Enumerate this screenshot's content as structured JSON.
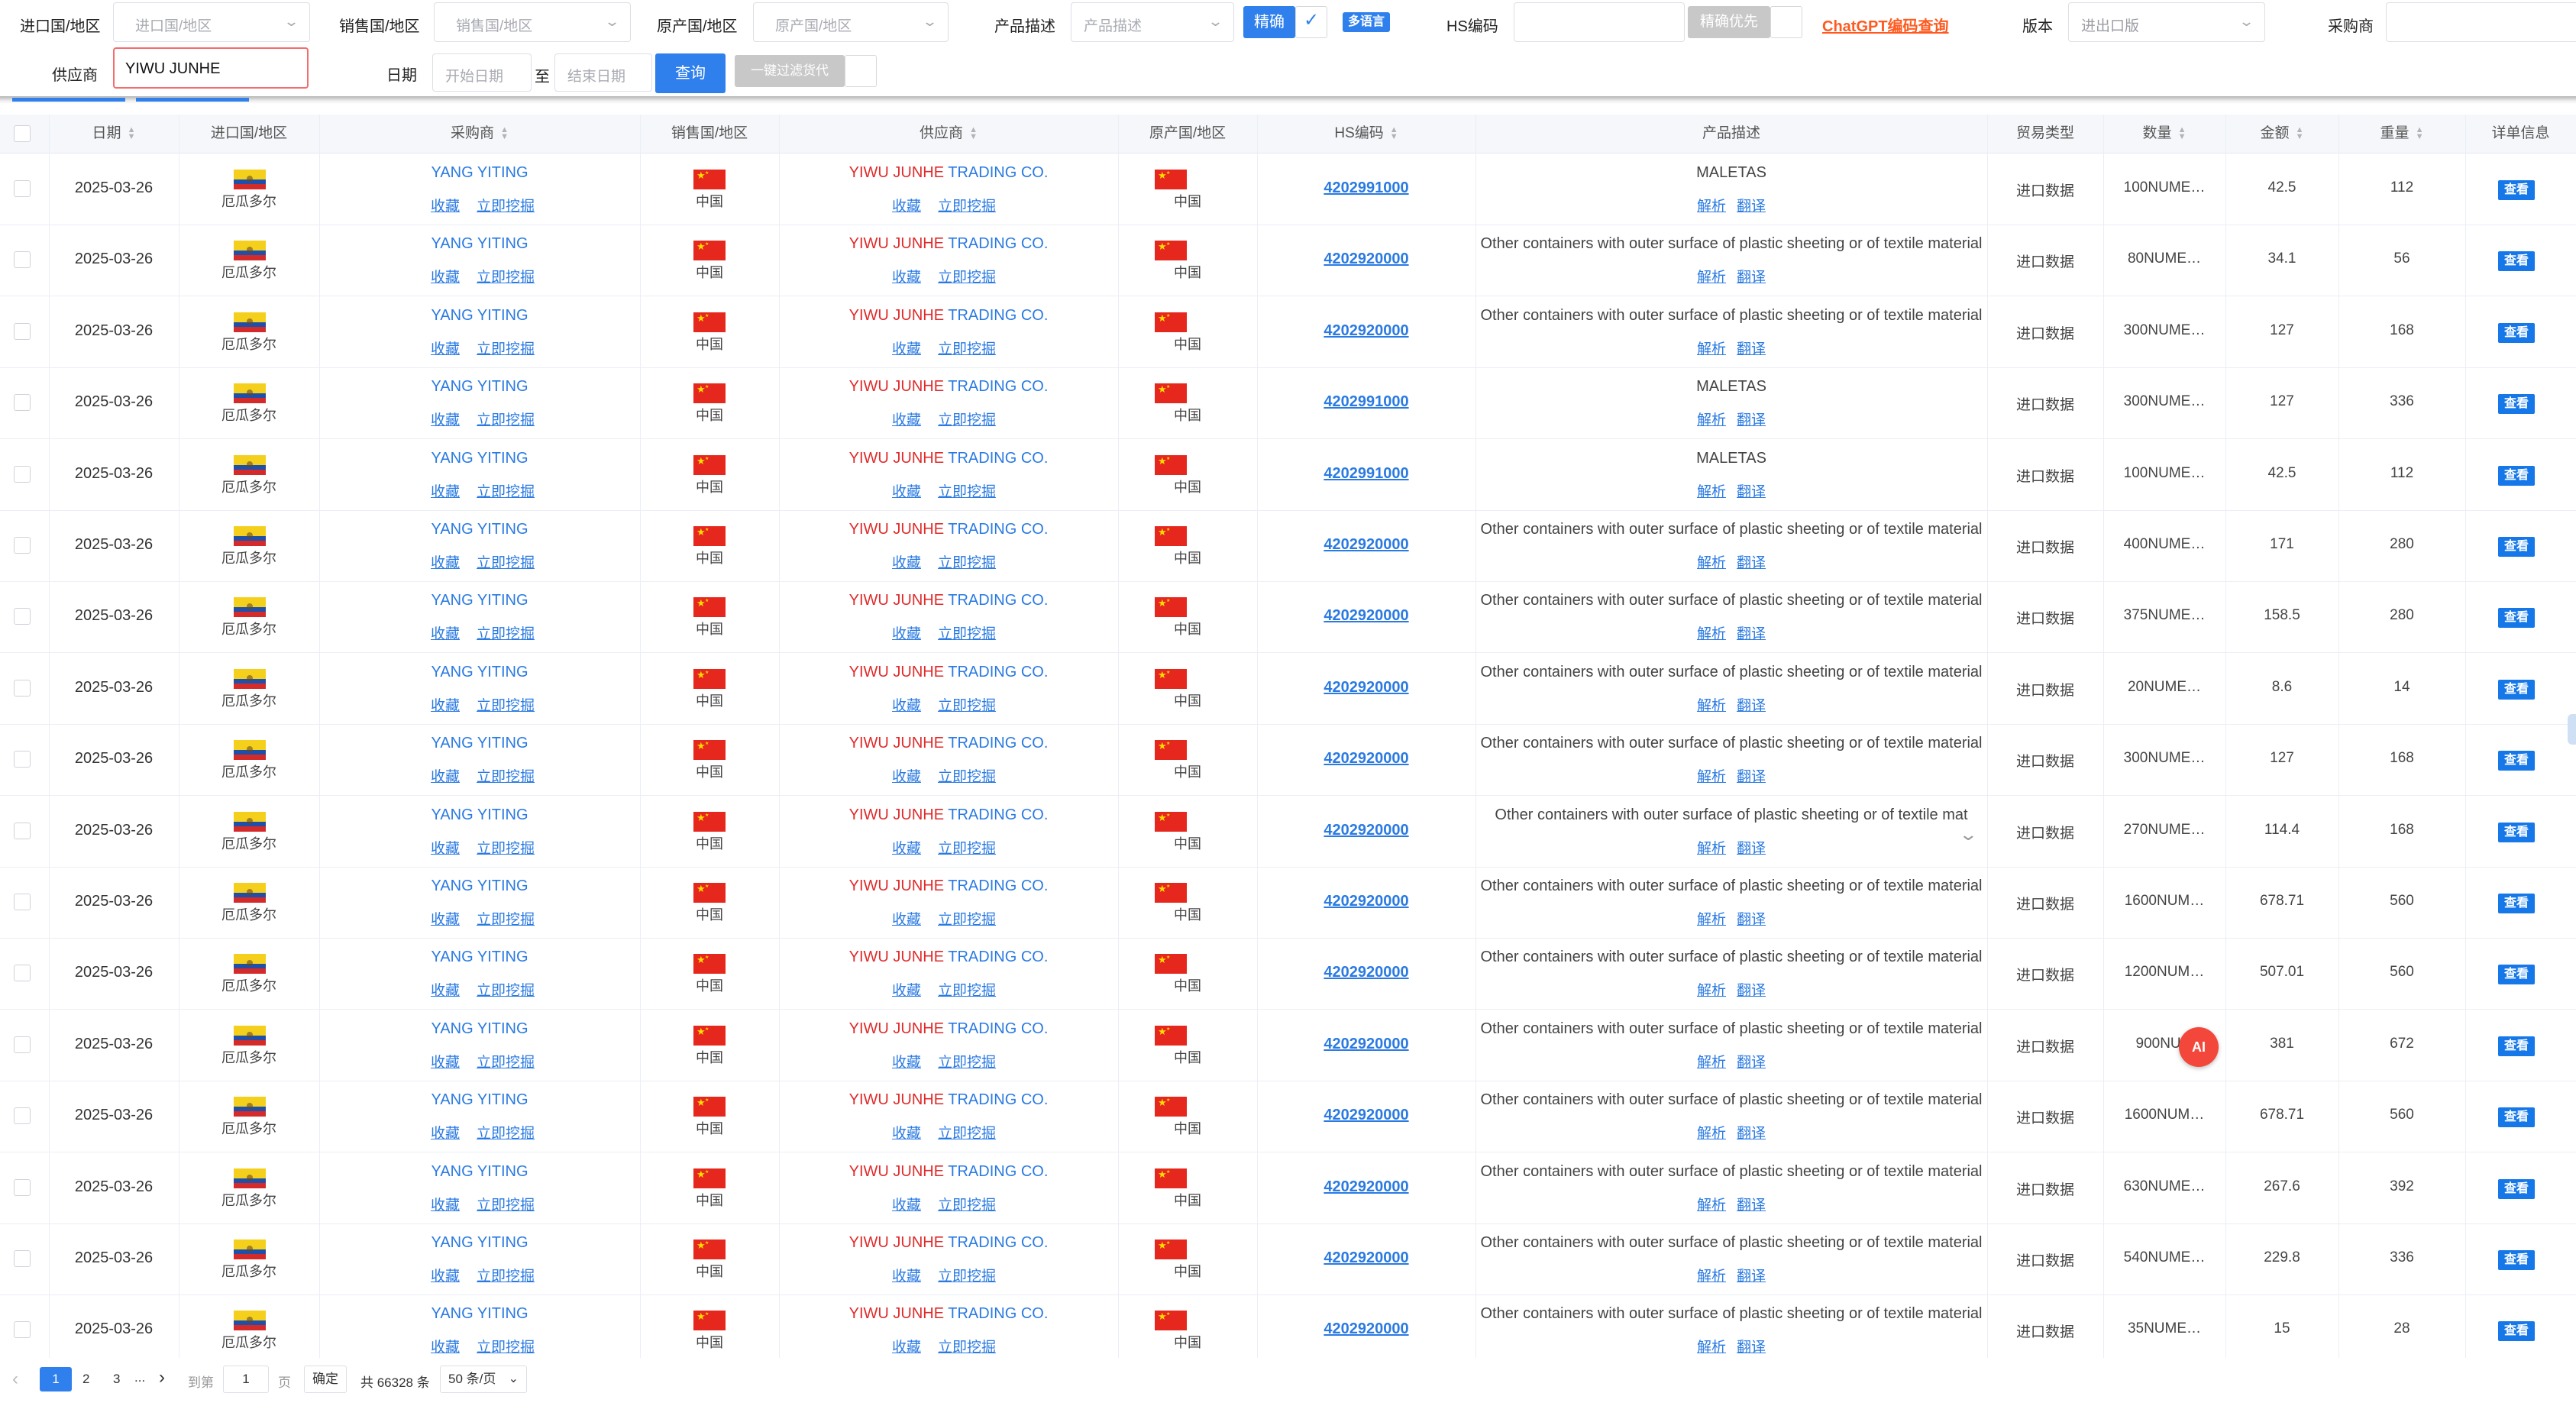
{
  "filters": {
    "import_country_label": "进口国/地区",
    "import_country_placeholder": "进口国/地区",
    "sales_country_label": "销售国/地区",
    "sales_country_placeholder": "销售国/地区",
    "origin_country_label": "原产国/地区",
    "origin_country_placeholder": "原产国/地区",
    "product_desc_label": "产品描述",
    "product_desc_placeholder": "产品描述",
    "exact_label": "精确",
    "multilang_label": "多语言",
    "hs_code_label": "HS编码",
    "exact_priority_label": "精确优先",
    "chatgpt_link": "ChatGPT编码查询",
    "version_label": "版本",
    "version_value": "进出口版",
    "buyer_label": "采购商",
    "supplier_label": "供应商",
    "supplier_value": "YIWU JUNHE",
    "date_label": "日期",
    "start_date_placeholder": "开始日期",
    "date_sep": "至",
    "end_date_placeholder": "结束日期",
    "query_button": "查询",
    "filter_goods_button": "一键过滤货代"
  },
  "table": {
    "headers": {
      "date": "日期",
      "import_country": "进口国/地区",
      "buyer": "采购商",
      "sales_country": "销售国/地区",
      "supplier": "供应商",
      "origin_country": "原产国/地区",
      "hs_code": "HS编码",
      "product_desc": "产品描述",
      "trade_type": "贸易类型",
      "quantity": "数量",
      "amount": "金额",
      "weight": "重量",
      "detail": "详单信息"
    },
    "row_actions": {
      "favorite": "收藏",
      "mine": "立即挖掘",
      "analyze": "解析",
      "translate": "翻译",
      "view": "查看"
    },
    "import_country_name": "厄瓜多尔",
    "china_name": "中国",
    "buyer_name": "YANG YITING",
    "supplier_name_highlight": "YIWU JUNHE",
    "supplier_name_rest": " TRADING CO.",
    "trade_type_value": "进口数据",
    "rows": [
      {
        "date": "2025-03-26",
        "hs": "4202991000",
        "desc": "MALETAS",
        "qty": "100NUME…",
        "amount": "42.5",
        "weight": "112"
      },
      {
        "date": "2025-03-26",
        "hs": "4202920000",
        "desc": "Other containers with outer surface of plastic sheeting or of textile material",
        "qty": "80NUME…",
        "amount": "34.1",
        "weight": "56"
      },
      {
        "date": "2025-03-26",
        "hs": "4202920000",
        "desc": "Other containers with outer surface of plastic sheeting or of textile material",
        "qty": "300NUME…",
        "amount": "127",
        "weight": "168"
      },
      {
        "date": "2025-03-26",
        "hs": "4202991000",
        "desc": "MALETAS",
        "qty": "300NUME…",
        "amount": "127",
        "weight": "336"
      },
      {
        "date": "2025-03-26",
        "hs": "4202991000",
        "desc": "MALETAS",
        "qty": "100NUME…",
        "amount": "42.5",
        "weight": "112"
      },
      {
        "date": "2025-03-26",
        "hs": "4202920000",
        "desc": "Other containers with outer surface of plastic sheeting or of textile material",
        "qty": "400NUME…",
        "amount": "171",
        "weight": "280"
      },
      {
        "date": "2025-03-26",
        "hs": "4202920000",
        "desc": "Other containers with outer surface of plastic sheeting or of textile material",
        "qty": "375NUME…",
        "amount": "158.5",
        "weight": "280"
      },
      {
        "date": "2025-03-26",
        "hs": "4202920000",
        "desc": "Other containers with outer surface of plastic sheeting or of textile material",
        "qty": "20NUME…",
        "amount": "8.6",
        "weight": "14"
      },
      {
        "date": "2025-03-26",
        "hs": "4202920000",
        "desc": "Other containers with outer surface of plastic sheeting or of textile material",
        "qty": "300NUME…",
        "amount": "127",
        "weight": "168"
      },
      {
        "date": "2025-03-26",
        "hs": "4202920000",
        "desc": "Other containers with outer surface of plastic sheeting or of textile mat",
        "qty": "270NUME…",
        "amount": "114.4",
        "weight": "168"
      },
      {
        "date": "2025-03-26",
        "hs": "4202920000",
        "desc": "Other containers with outer surface of plastic sheeting or of textile material",
        "qty": "1600NUM…",
        "amount": "678.71",
        "weight": "560"
      },
      {
        "date": "2025-03-26",
        "hs": "4202920000",
        "desc": "Other containers with outer surface of plastic sheeting or of textile material",
        "qty": "1200NUM…",
        "amount": "507.01",
        "weight": "560"
      },
      {
        "date": "2025-03-26",
        "hs": "4202920000",
        "desc": "Other containers with outer surface of plastic sheeting or of textile material",
        "qty": "900NUM",
        "amount": "381",
        "weight": "672"
      },
      {
        "date": "2025-03-26",
        "hs": "4202920000",
        "desc": "Other containers with outer surface of plastic sheeting or of textile material",
        "qty": "1600NUM…",
        "amount": "678.71",
        "weight": "560"
      },
      {
        "date": "2025-03-26",
        "hs": "4202920000",
        "desc": "Other containers with outer surface of plastic sheeting or of textile material",
        "qty": "630NUME…",
        "amount": "267.6",
        "weight": "392"
      },
      {
        "date": "2025-03-26",
        "hs": "4202920000",
        "desc": "Other containers with outer surface of plastic sheeting or of textile material",
        "qty": "540NUME…",
        "amount": "229.8",
        "weight": "336"
      },
      {
        "date": "2025-03-26",
        "hs": "4202920000",
        "desc": "Other containers with outer surface of plastic sheeting or of textile material",
        "qty": "35NUME…",
        "amount": "15",
        "weight": "28"
      }
    ]
  },
  "pagination": {
    "prev": "‹",
    "pages": [
      "1",
      "2",
      "3"
    ],
    "ellipsis": "...",
    "next": "›",
    "goto_label": "到第",
    "goto_value": "1",
    "page_unit": "页",
    "confirm": "确定",
    "total": "共 66328 条",
    "page_size": "50 条/页"
  },
  "ai_badge": "AI",
  "colors": {
    "primary": "#2f80ed",
    "highlight_red": "#e02a2a",
    "link_orange": "#ff5a1f"
  }
}
